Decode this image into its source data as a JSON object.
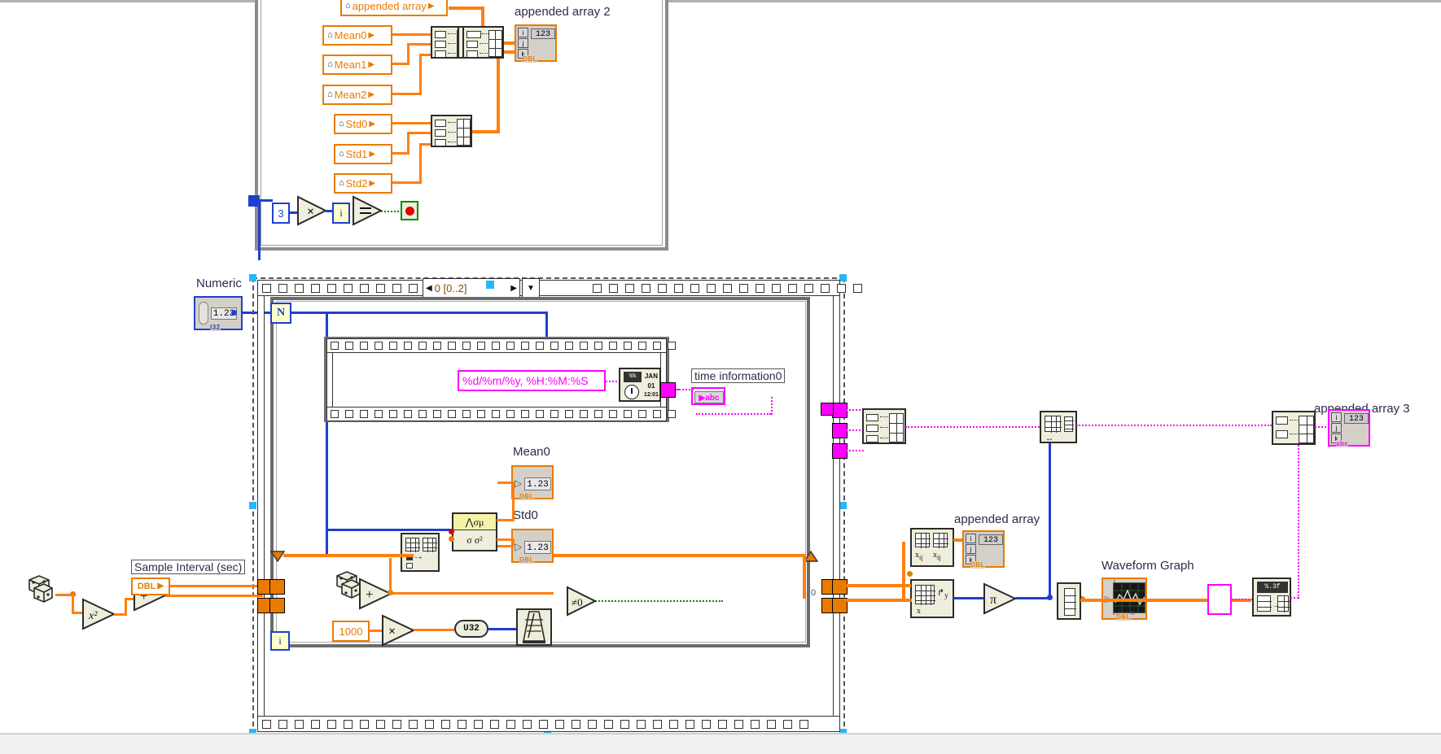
{
  "app": {
    "type": "LabVIEW Block Diagram",
    "background": "#ffffff",
    "colors": {
      "wire_numeric": "#E87B00",
      "wire_integer": "#1f3fd0",
      "wire_string": "#FF00FF",
      "wire_boolean": "#0a8a0a",
      "node_fill": "#efeedc",
      "structure_border": "#8c8c8c"
    }
  },
  "top_section": {
    "locals": [
      {
        "label": "appended array",
        "type": "local-variable"
      },
      {
        "label": "Mean0",
        "type": "local-variable"
      },
      {
        "label": "Mean1",
        "type": "local-variable"
      },
      {
        "label": "Mean2",
        "type": "local-variable"
      },
      {
        "label": "Std0",
        "type": "local-variable"
      },
      {
        "label": "Std1",
        "type": "local-variable"
      },
      {
        "label": "Std2",
        "type": "local-variable"
      }
    ],
    "indicator": {
      "label": "appended array 2",
      "dims": [
        "i",
        "j",
        "k"
      ],
      "value": "123",
      "datatype": "DBL"
    },
    "loop_logic": {
      "constant": "3",
      "multiply": "x",
      "iteration_terminal": "i",
      "compare": "=",
      "stop_button": "stop"
    }
  },
  "numeric_control": {
    "label": "Numeric",
    "value": "1.23",
    "datatype": "I32"
  },
  "sequence": {
    "selector": "0 [0..2]",
    "left_arrow": "◀",
    "right_arrow": "▶",
    "dropdown": "▼",
    "caption": "Stacked Sequence Structure"
  },
  "for_loop": {
    "count_terminal": "N",
    "iteration_terminal": "i"
  },
  "time_frame": {
    "format_string": "%d/%m/%y, %H:%M:%S",
    "node": "format-date-time-string",
    "node_glyph": "JAN 01 12:01",
    "indicator_label": "time information0",
    "indicator_type": "abc"
  },
  "statistics": {
    "node_top_glyph": "σ μ",
    "node_bottom_glyph": "σ σ²",
    "mean": {
      "label": "Mean0",
      "value": "1.23",
      "datatype": "DBL"
    },
    "std": {
      "label": "Std0",
      "value": "1.23",
      "datatype": "DBL"
    }
  },
  "acquisition": {
    "random_number": "random-number-dice",
    "square": "x²",
    "add": "+",
    "sample_interval": {
      "label": "Sample Interval (sec)",
      "datatype": "DBL"
    },
    "multiply": "x",
    "ms_constant": "1000",
    "to_u32": "U32",
    "wait_node": "wait-ms-metronome",
    "zero_constant": "0"
  },
  "right_section": {
    "appended_array": {
      "label": "appended array",
      "dims": [
        "i",
        "j",
        "k"
      ],
      "value": "123",
      "datatype": "DBL"
    },
    "appended_array_3": {
      "label": "appended array 3",
      "dims": [
        "i",
        "j",
        "k"
      ],
      "value": "123",
      "datatype": "abc"
    },
    "waveform_graph": {
      "label": "Waveform Graph",
      "datatype": "DBL"
    },
    "transpose_node": "transpose-2d-array",
    "pi_constant": "π",
    "empty_string_constant": "",
    "number_to_string": "number-to-decimal-string"
  }
}
